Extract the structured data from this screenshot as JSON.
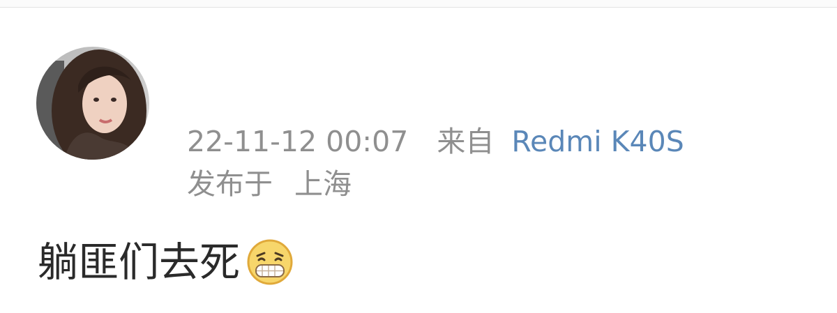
{
  "post": {
    "timestamp": "22-11-12 00:07",
    "source_prefix": "来自",
    "device": "Redmi K40S",
    "location_prefix": "发布于",
    "location": "上海",
    "text": "躺匪们去死",
    "emoji_name": "grin-emoji"
  },
  "colors": {
    "device_link": "#5a87b8",
    "meta_text": "#8f8f8f",
    "body_text": "#2a2a2a"
  }
}
